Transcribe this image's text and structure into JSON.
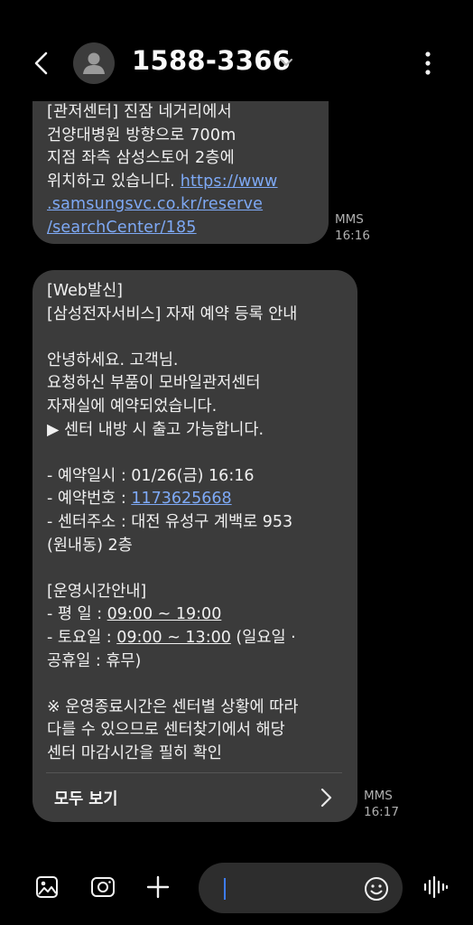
{
  "header": {
    "contact": "1588-3366"
  },
  "messages": [
    {
      "lines": [
        "[관저센터] 진잠 네거리에서",
        "건양대병원 방향으로 700m",
        "지점 좌측 삼성스토어  2층에",
        "위치하고 있습니다. "
      ],
      "link_part1": "https://www",
      "link_part2": ".samsungsvc.co.kr/reserve",
      "link_part3": "/searchCenter/185",
      "type": "MMS",
      "time": "16:16"
    },
    {
      "line1": "[Web발신]",
      "line2": "[삼성전자서비스] 자재 예약 등록 안내",
      "line3": "안녕하세요. 고객님.",
      "line4": "요청하신 부품이 모바일관저센터",
      "line5": "자재실에 예약되었습니다.",
      "line6": "▶ 센터 내방 시 출고 가능합니다.",
      "date_label": "- 예약일시 : 01/26(금) 16:16",
      "no_label": "- 예약번호 : ",
      "no_value": "1173625668",
      "addr_line1": "- 센터주소 : 대전 유성구 계백로 953",
      "addr_line2": "(원내동) 2층",
      "hours_title": "[운영시간안내]",
      "weekday_label": "- 평  일 : ",
      "weekday_value": "09:00 ~ 19:00",
      "sat_label": "- 토요일 : ",
      "sat_value": "09:00 ~ 13:00",
      "sat_note": " (일요일 ·",
      "holiday_line": "공휴일 : 휴무)",
      "notice1": "※ 운영종료시간은 센터별 상황에 따라",
      "notice2": "다를 수 있으므로 센터찾기에서 해당",
      "notice3": "센터 마감시간을 필히 확인",
      "view_all": "모두 보기",
      "type": "MMS",
      "time": "16:17"
    }
  ],
  "icons": {
    "back": "chevron-left-icon",
    "avatar": "person-icon",
    "more": "more-vertical-icon",
    "gallery": "image-icon",
    "camera": "camera-icon",
    "add": "plus-icon",
    "emoji": "emoji-icon",
    "voice": "voice-waveform-icon"
  },
  "colors": {
    "background": "#000000",
    "bubble": "#3b3b3b",
    "link": "#7ea9f5",
    "caret": "#3d7cf7"
  }
}
